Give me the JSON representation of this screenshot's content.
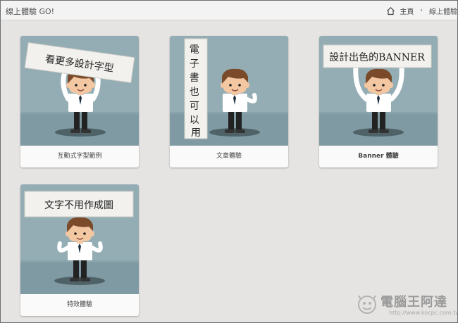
{
  "header": {
    "site_title": "線上體驗 GO!",
    "breadcrumb": {
      "home": "主頁",
      "separator": "›",
      "current": "線上體驗"
    }
  },
  "cards": [
    {
      "sign": "看更多設計字型",
      "caption": "互動式字型範例"
    },
    {
      "sign_lines": [
        "電",
        "子",
        "書",
        "也",
        "可",
        "以",
        "用"
      ],
      "caption": "文章體驗"
    },
    {
      "sign": "設計出色的BANNER",
      "caption": "Banner 體驗"
    },
    {
      "sign": "文字不用作成圖",
      "caption": "特效體驗"
    }
  ],
  "watermark": {
    "name": "電腦王阿達",
    "url": "http://www.kocpc.com.tw"
  },
  "colors": {
    "page_bg": "#e6e4e2",
    "wall": "#94adb4",
    "floor": "#7f9aa2",
    "sign": "#f2f1ee",
    "skin": "#f2c7a2",
    "hair": "#7a4a2a",
    "shirt": "#ffffff"
  },
  "icons": [
    "home-icon",
    "chevron-right-icon",
    "kocpc-logo-icon"
  ]
}
